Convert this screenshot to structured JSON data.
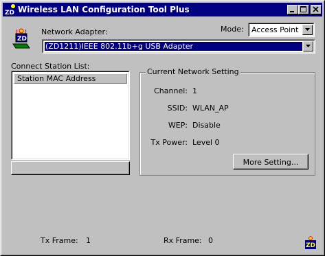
{
  "window": {
    "title": "Wireless LAN Configuration Tool Plus",
    "title_icon_text": "ZD",
    "controls": [
      "minimize-icon",
      "maximize-icon",
      "close-icon"
    ]
  },
  "adapter": {
    "label": "Network Adapter:",
    "selected": "(ZD1211)IEEE 802.11b+g USB Adapter"
  },
  "mode": {
    "label": "Mode:",
    "selected": "Access Point"
  },
  "station_list": {
    "label": "Connect Station List:",
    "column_header": "Station MAC Address",
    "rows": []
  },
  "network_setting": {
    "title": "Current Network Setting",
    "channel_label": "Channel:",
    "channel_value": "1",
    "ssid_label": "SSID:",
    "ssid_value": "WLAN_AP",
    "wep_label": "WEP:",
    "wep_value": "Disable",
    "txpower_label": "Tx Power:",
    "txpower_value": "Level 0",
    "more_button": "More Setting..."
  },
  "status": {
    "tx_label": "Tx Frame:",
    "tx_value": "1",
    "rx_label": "Rx Frame:",
    "rx_value": "0",
    "logo_text": "ZD"
  },
  "colors": {
    "titlebar": "#000080",
    "face": "#c0c0c0",
    "selection": "#000080"
  }
}
